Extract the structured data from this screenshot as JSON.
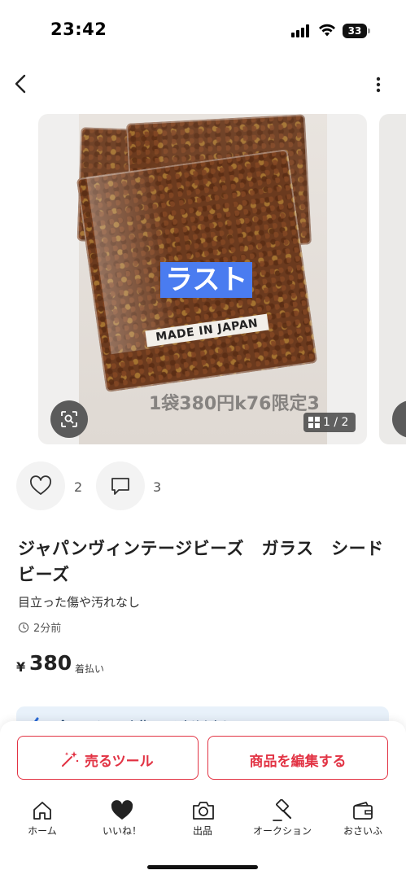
{
  "status_bar": {
    "time": "23:42",
    "battery": "33"
  },
  "carousel": {
    "photo_labels": {
      "tag": "ラスト",
      "origin": "MADE IN JAPAN",
      "price_note": "1袋380円k76限定3"
    },
    "counter": "1 / 2"
  },
  "reactions": {
    "likes": "2",
    "comments": "3"
  },
  "item": {
    "title": "ジャパンヴィンテージビーズ　ガラス　シードビーズ",
    "condition": "目立った傷や汚れなし",
    "posted": "2分前",
    "price_symbol": "¥",
    "price": "380",
    "shipping": "着払い"
  },
  "promo": {
    "text": "プロモーションを使ってみませんか？"
  },
  "actions": {
    "sell_tool": "売るツール",
    "edit": "商品を編集する"
  },
  "tabs": [
    {
      "label": "ホーム",
      "icon": "home-icon"
    },
    {
      "label": "いいね！",
      "icon": "heart-filled-icon"
    },
    {
      "label": "出品",
      "icon": "camera-icon"
    },
    {
      "label": "オークション",
      "icon": "gavel-icon"
    },
    {
      "label": "おさいふ",
      "icon": "wallet-icon"
    }
  ],
  "colors": {
    "accent": "#e23344",
    "tag_blue": "#4a7cf0",
    "promo_bg": "#e8f1fa"
  }
}
